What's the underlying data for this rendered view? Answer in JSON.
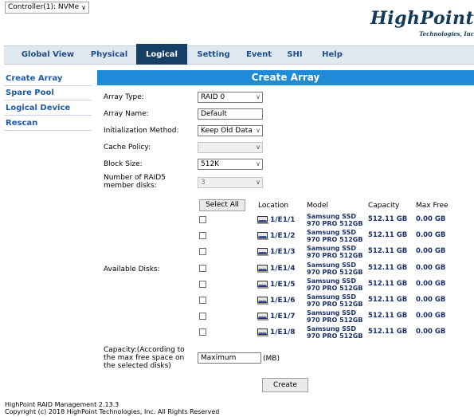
{
  "controller": {
    "value": "Controller(1): NVMe"
  },
  "logo": {
    "brand": "HighPoint",
    "sub": "Technologies, Inc"
  },
  "nav": {
    "tabs": [
      "Global View",
      "Physical",
      "Logical",
      "Setting",
      "Event",
      "SHI",
      "Help"
    ],
    "active": "Logical"
  },
  "sidebar": {
    "items": [
      "Create Array",
      "Spare Pool",
      "Logical Device",
      "Rescan"
    ]
  },
  "main": {
    "title": "Create Array",
    "array_type": {
      "label": "Array Type:",
      "value": "RAID 0"
    },
    "array_name": {
      "label": "Array Name:",
      "value": "Default"
    },
    "init_method": {
      "label": "Initialization Method:",
      "value": "Keep Old Data"
    },
    "cache_policy": {
      "label": "Cache Policy:",
      "value": ""
    },
    "block_size": {
      "label": "Block Size:",
      "value": "512K"
    },
    "raid5_disks": {
      "label1": "Number of RAID5",
      "label2": "member disks:",
      "value": "3"
    },
    "available_disks_label": "Available Disks:",
    "select_all": "Select All",
    "columns": {
      "location": "Location",
      "model": "Model",
      "capacity": "Capacity",
      "max_free": "Max Free"
    },
    "disks": [
      {
        "location": "1/E1/1",
        "model1": "Samsung SSD",
        "model2": "970 PRO 512GB",
        "capacity": "512.11 GB",
        "max_free": "0.00 GB"
      },
      {
        "location": "1/E1/2",
        "model1": "Samsung SSD",
        "model2": "970 PRO 512GB",
        "capacity": "512.11 GB",
        "max_free": "0.00 GB"
      },
      {
        "location": "1/E1/3",
        "model1": "Samsung SSD",
        "model2": "970 PRO 512GB",
        "capacity": "512.11 GB",
        "max_free": "0.00 GB"
      },
      {
        "location": "1/E1/4",
        "model1": "Samsung SSD",
        "model2": "970 PRO 512GB",
        "capacity": "512.11 GB",
        "max_free": "0.00 GB"
      },
      {
        "location": "1/E1/5",
        "model1": "Samsung SSD",
        "model2": "970 PRO 512GB",
        "capacity": "512.11 GB",
        "max_free": "0.00 GB"
      },
      {
        "location": "1/E1/6",
        "model1": "Samsung SSD",
        "model2": "970 PRO 512GB",
        "capacity": "512.11 GB",
        "max_free": "0.00 GB"
      },
      {
        "location": "1/E1/7",
        "model1": "Samsung SSD",
        "model2": "970 PRO 512GB",
        "capacity": "512.11 GB",
        "max_free": "0.00 GB"
      },
      {
        "location": "1/E1/8",
        "model1": "Samsung SSD",
        "model2": "970 PRO 512GB",
        "capacity": "512.11 GB",
        "max_free": "0.00 GB"
      }
    ],
    "capacity": {
      "label1": "Capacity:(According to",
      "label2": "the max free space on",
      "label3": "the selected disks)",
      "value": "Maximum",
      "unit": "(MB)"
    },
    "create_button": "Create"
  },
  "footer": {
    "line1": "HighPoint RAID Management 2.13.3",
    "line2": "Copyright (c) 2018 HighPoint Technologies, Inc. All Rights Reserved"
  },
  "colors": {
    "nav_bg": "#dfe7ef",
    "active_tab": "#173f66",
    "title_bar": "#1f8ad8",
    "link_blue": "#1e5aa8",
    "disk_text": "#1a2f6e"
  }
}
